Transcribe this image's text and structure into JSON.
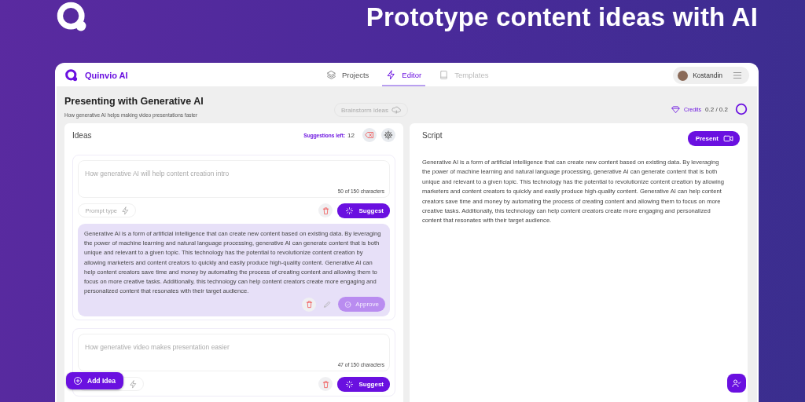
{
  "header": {
    "headline": "Prototype content ideas with AI"
  },
  "app": {
    "name": "Quinvio AI"
  },
  "tabs": [
    {
      "label": "Projects",
      "selected": false,
      "disabled": false
    },
    {
      "label": "Editor",
      "selected": true,
      "disabled": false
    },
    {
      "label": "Templates",
      "selected": false,
      "disabled": true
    }
  ],
  "user": {
    "name": "Kostandin"
  },
  "project": {
    "title": "Presenting with Generative AI",
    "subtitle": "How generative AI helps making video presentations faster",
    "brainstorm_button": "Brainstorm ideas"
  },
  "credits": {
    "label": "Credits",
    "value": "0.2 / 0.2"
  },
  "ideas_panel": {
    "title": "Ideas",
    "suggestions_label": "Suggestions left:",
    "suggestions_count": "12",
    "add_button": "Add Idea",
    "ideas": [
      {
        "text": "How generative AI will help content creation intro",
        "char_count": "50 of 150 characters",
        "prompt_type": "Prompt type",
        "suggest_button": "Suggest",
        "suggestion": {
          "text": "Generative AI is a form of artificial intelligence that can create new content based on existing data. By leveraging the power of machine learning and natural language processing, generative AI can generate content that is both unique and relevant to a given topic. This technology has the potential to revolutionize content creation by allowing marketers and content creators to quickly and easily produce high-quality content. Generative AI can help content creators save time and money by automating the process of creating content and allowing them to focus on more creative tasks. Additionally, this technology can help content creators create more engaging and personalized content that resonates with their target audience.",
          "approve_button": "Approve",
          "approve_disabled": true
        }
      },
      {
        "text": "How generative video makes presentation easier",
        "char_count": "47 of 150 characters",
        "suggest_button": "Suggest"
      }
    ]
  },
  "script_panel": {
    "title": "Script",
    "present_button": "Present",
    "text": "Generative AI is a form of artificial intelligence that can create new content based on existing data. By leveraging the power of machine learning and natural language processing, generative AI can generate content that is both unique and relevant to a given topic. This technology has the potential to revolutionize content creation by allowing marketers and content creators to quickly and easily produce high-quality content. Generative AI can help content creators save time and money by automating the process of creating content and allowing them to focus on more creative tasks. Additionally, this technology can help content creators create more engaging and personalized content that resonates with their target audience."
  }
}
